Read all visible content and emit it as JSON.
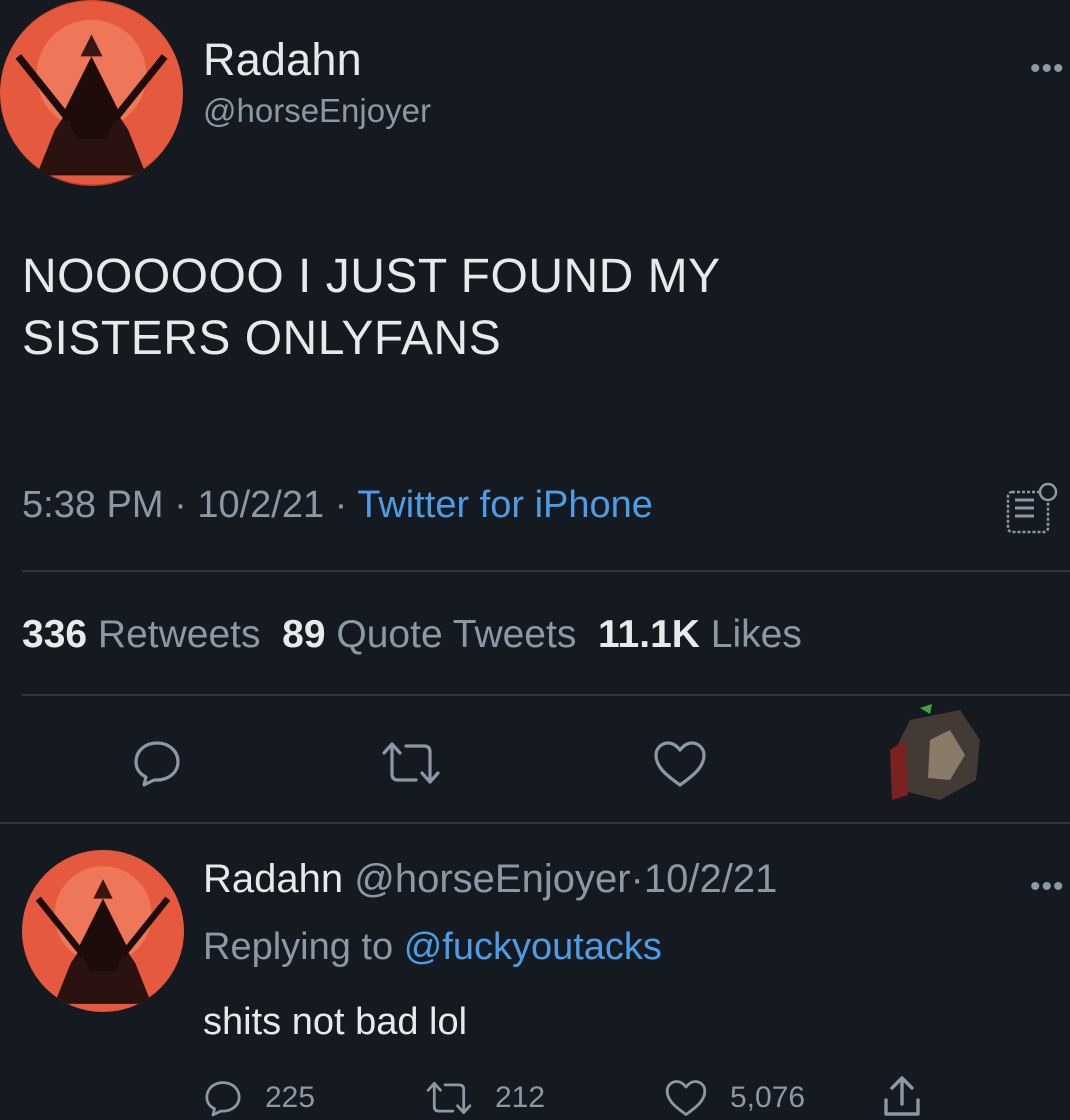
{
  "tweet": {
    "display_name": "Radahn",
    "handle": "@horseEnjoyer",
    "more_label": "•••",
    "text_line1": "NOOOOOO I JUST FOUND MY",
    "text_line2": "SISTERS ONLYFANS",
    "time": "5:38 PM",
    "date": "10/2/21",
    "separator": "·",
    "source": "Twitter for iPhone",
    "stats": {
      "retweets_count": "336",
      "retweets_label": "Retweets",
      "quotes_count": "89",
      "quotes_label": "Quote Tweets",
      "likes_count": "11.1K",
      "likes_label": "Likes"
    }
  },
  "reply": {
    "display_name": "Radahn",
    "handle": "@horseEnjoyer",
    "separator": "·",
    "date": "10/2/21",
    "replying_prefix": "Replying to",
    "replying_mention": "@fuckyoutacks",
    "text": "shits not bad lol",
    "more_label": "•••",
    "counts": {
      "replies": "225",
      "retweets": "212",
      "likes": "5,076"
    }
  },
  "icons": [
    "reply-icon",
    "retweet-icon",
    "like-icon",
    "share-icon",
    "analytics-icon",
    "more-icon"
  ],
  "colors": {
    "background": "#151a21",
    "text_primary": "#e7e9ea",
    "text_secondary": "#8b98a5",
    "link": "#4a9de6",
    "divider": "#2f3640"
  }
}
